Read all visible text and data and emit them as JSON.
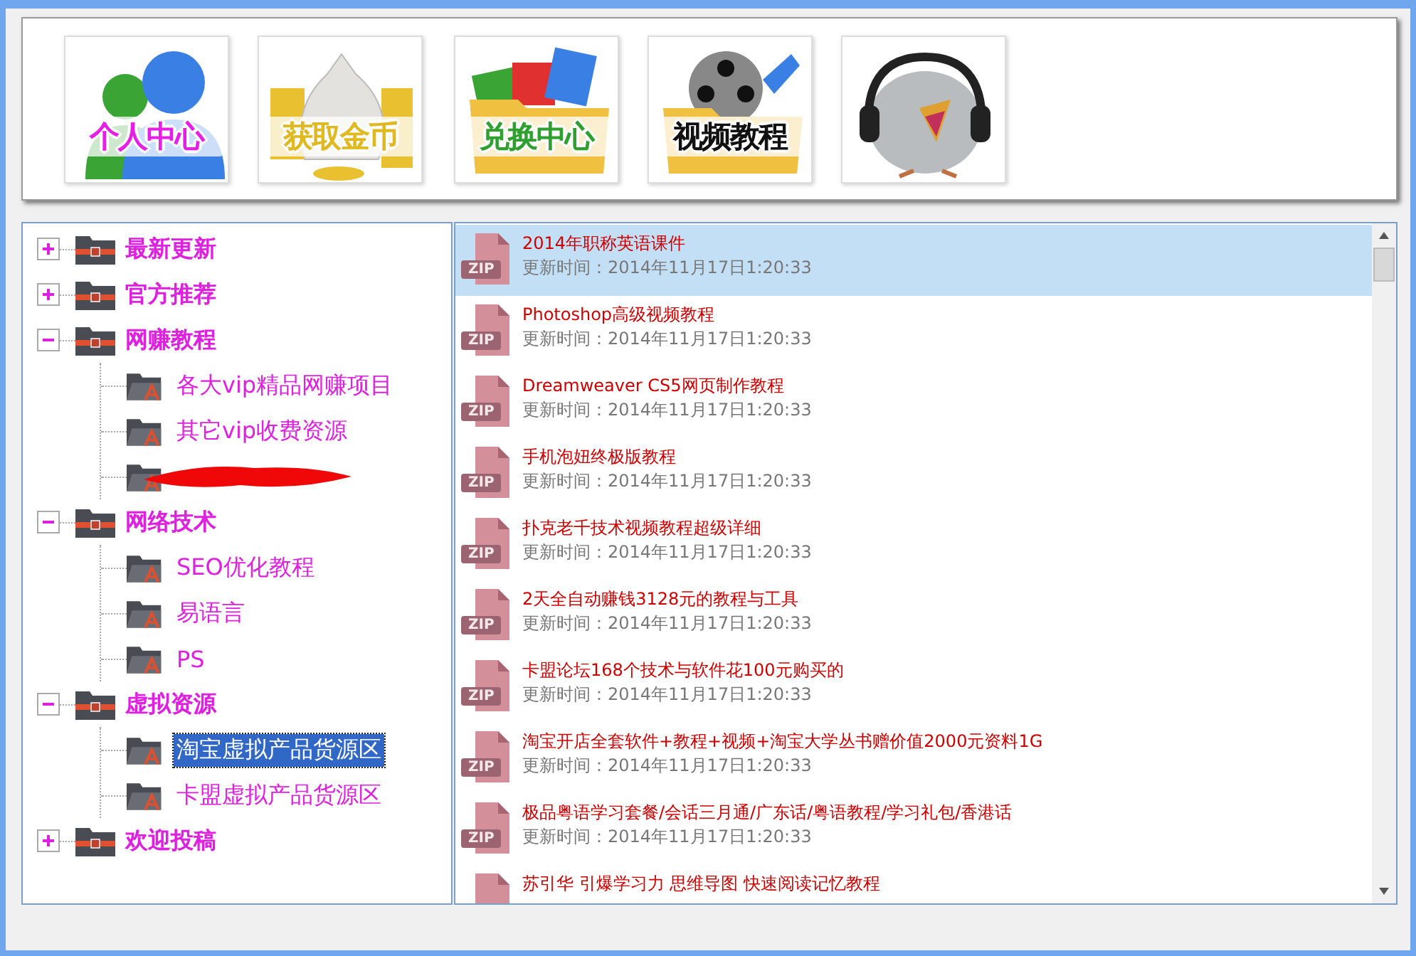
{
  "tiles": [
    {
      "kind": "people",
      "caption": "个人中心",
      "color": "#e81ee8"
    },
    {
      "kind": "money",
      "caption": "获取金币",
      "color": "#e0b820"
    },
    {
      "kind": "cards",
      "caption": "兑换中心",
      "color": "#2ea02e"
    },
    {
      "kind": "film",
      "caption": "视频教程",
      "color": "#111111"
    },
    {
      "kind": "bird"
    }
  ],
  "tree": {
    "items": [
      {
        "label": "最新更新",
        "expanded": false
      },
      {
        "label": "官方推荐",
        "expanded": false
      },
      {
        "label": "网赚教程",
        "expanded": true,
        "children": [
          {
            "kind": "item",
            "label": "各大vip精品网赚项目",
            "selected": false
          },
          {
            "kind": "item",
            "label": "其它vip收费资源",
            "selected": false
          },
          {
            "kind": "redacted",
            "selected": false
          }
        ]
      },
      {
        "label": "网络技术",
        "expanded": true,
        "children": [
          {
            "kind": "item",
            "label": "SEO优化教程",
            "selected": false
          },
          {
            "kind": "item",
            "label": "易语言",
            "selected": false
          },
          {
            "kind": "item",
            "label": "PS",
            "selected": false
          }
        ]
      },
      {
        "label": "虚拟资源",
        "expanded": true,
        "children": [
          {
            "kind": "item",
            "label": "淘宝虚拟产品货源区",
            "selected": true
          },
          {
            "kind": "item",
            "label": "卡盟虚拟产品货源区",
            "selected": false
          }
        ]
      },
      {
        "label": "欢迎投稿",
        "expanded": false
      }
    ]
  },
  "files": [
    {
      "badge": "ZIP",
      "title": "2014年职称英语课件",
      "time": "更新时间：2014年11月17日1:20:33",
      "selected": true
    },
    {
      "badge": "ZIP",
      "title": "Photoshop高级视频教程",
      "time": "更新时间：2014年11月17日1:20:33",
      "selected": false
    },
    {
      "badge": "ZIP",
      "title": "Dreamweaver CS5网页制作教程",
      "time": "更新时间：2014年11月17日1:20:33",
      "selected": false
    },
    {
      "badge": "ZIP",
      "title": "手机泡妞终极版教程",
      "time": "更新时间：2014年11月17日1:20:33",
      "selected": false
    },
    {
      "badge": "ZIP",
      "title": "扑克老千技术视频教程超级详细",
      "time": "更新时间：2014年11月17日1:20:33",
      "selected": false
    },
    {
      "badge": "ZIP",
      "title": "2天全自动赚钱3128元的教程与工具",
      "time": "更新时间：2014年11月17日1:20:33",
      "selected": false
    },
    {
      "badge": "ZIP",
      "title": "卡盟论坛168个技术与软件花100元购买的",
      "time": "更新时间：2014年11月17日1:20:33",
      "selected": false
    },
    {
      "badge": "ZIP",
      "title": "淘宝开店全套软件+教程+视频+淘宝大学丛书赠价值2000元资料1G",
      "time": "更新时间：2014年11月17日1:20:33",
      "selected": false
    },
    {
      "badge": "ZIP",
      "title": "极品粤语学习套餐/会话三月通/广东话/粤语教程/学习礼包/香港话",
      "time": "更新时间：2014年11月17日1:20:33",
      "selected": false
    },
    {
      "title": "苏引华 引爆学习力 思维导图 快速阅读记忆教程",
      "selected": false
    }
  ]
}
